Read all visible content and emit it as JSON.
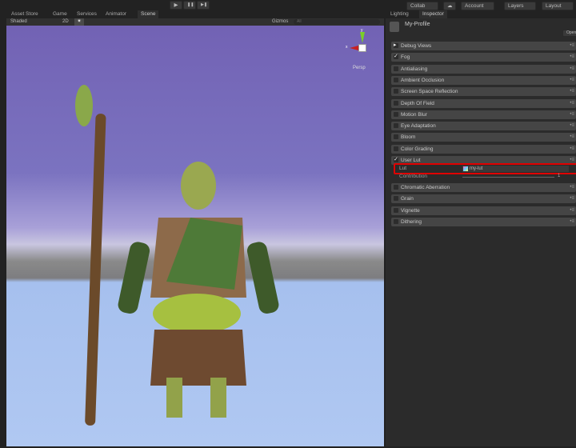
{
  "toolbar": {
    "play": "▶",
    "pause": "❚❚",
    "step": "▶❚",
    "collab": "Collab",
    "account": "Account",
    "layers": "Layers",
    "layout": "Layout"
  },
  "scene_tabs": [
    "Asset Store",
    "Game",
    "Services",
    "Animator",
    "Scene"
  ],
  "scene_toolbar": {
    "shading": "Shaded",
    "mode_2d": "2D",
    "gizmos": "Gizmos",
    "search_placeholder": "All"
  },
  "gizmo": {
    "y": "y",
    "x": "x",
    "persp": "Persp"
  },
  "inspector_tabs": [
    "Lighting",
    "Inspector"
  ],
  "inspector": {
    "title": "My-Profile",
    "open_label": "Open",
    "effects": [
      {
        "label": "Debug Views",
        "checked": false,
        "foldout": true
      },
      {
        "label": "Fog",
        "checked": true
      },
      {
        "label": "Antialiasing",
        "checked": false
      },
      {
        "label": "Ambient Occlusion",
        "checked": false
      },
      {
        "label": "Screen Space Reflection",
        "checked": false
      },
      {
        "label": "Depth Of Field",
        "checked": false
      },
      {
        "label": "Motion Blur",
        "checked": false
      },
      {
        "label": "Eye Adaptation",
        "checked": false
      },
      {
        "label": "Bloom",
        "checked": false
      },
      {
        "label": "Color Grading",
        "checked": false
      },
      {
        "label": "User Lut",
        "checked": true
      }
    ],
    "lut": {
      "label": "Lut",
      "value": "my-lut"
    },
    "contribution": {
      "label": "Contribution",
      "value": "1",
      "fraction": 1
    },
    "effects2": [
      {
        "label": "Chromatic Aberration",
        "checked": false
      },
      {
        "label": "Grain",
        "checked": false
      },
      {
        "label": "Vignette",
        "checked": false
      },
      {
        "label": "Dithering",
        "checked": false
      }
    ]
  },
  "colors": {
    "highlight": "#e00000",
    "sky": "#7a6cb8",
    "ground": "#a9c4f0"
  }
}
